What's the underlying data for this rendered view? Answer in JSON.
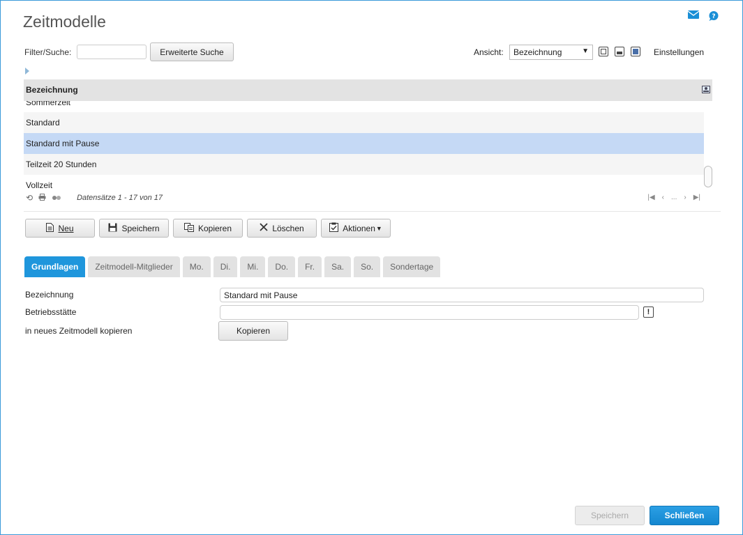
{
  "header": {
    "title": "Zeitmodelle"
  },
  "filter": {
    "label": "Filter/Suche:",
    "value": "",
    "extended_search_label": "Erweiterte Suche"
  },
  "view": {
    "label": "Ansicht:",
    "selected": "Bezeichnung",
    "settings_label": "Einstellungen"
  },
  "table": {
    "column": "Bezeichnung",
    "rows": [
      "Sommerzeit",
      "Standard",
      "Standard mit Pause",
      "Teilzeit 20 Stunden",
      "Vollzeit"
    ],
    "selected_row": "Standard mit Pause",
    "status": "Datensätze 1 - 17 von 17",
    "pager_ellipsis": "..."
  },
  "actions": {
    "new": "Neu",
    "save": "Speichern",
    "copy": "Kopieren",
    "delete": "Löschen",
    "actions": "Aktionen"
  },
  "tabs": [
    "Grundlagen",
    "Zeitmodell-Mitglieder",
    "Mo.",
    "Di.",
    "Mi.",
    "Do.",
    "Fr.",
    "Sa.",
    "So.",
    "Sondertage"
  ],
  "form": {
    "bezeichnung_label": "Bezeichnung",
    "bezeichnung_value": "Standard mit Pause",
    "betriebsstaette_label": "Betriebsstätte",
    "betriebsstaette_value": "",
    "copy_label": "in neues Zeitmodell kopieren",
    "copy_button": "Kopieren",
    "info_button": "!"
  },
  "footer": {
    "save": "Speichern",
    "close": "Schließen"
  },
  "colors": {
    "accent": "#1f96dc",
    "selected_row": "#c5d9f5"
  }
}
